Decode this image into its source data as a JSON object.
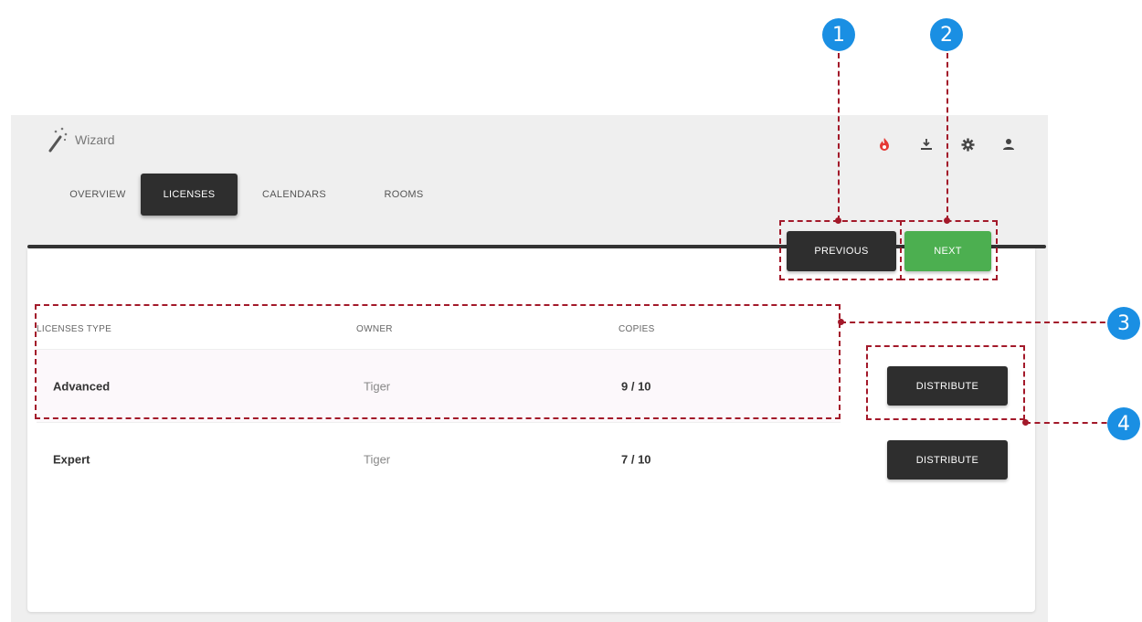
{
  "app": {
    "title": "Wizard"
  },
  "toolbar": {
    "icons": [
      "fire-icon",
      "download-icon",
      "gear-icon",
      "user-icon"
    ],
    "fire_color": "#e53935"
  },
  "tabs": [
    {
      "label": "OVERVIEW",
      "active": false
    },
    {
      "label": "LICENSES",
      "active": true
    },
    {
      "label": "CALENDARS",
      "active": false
    },
    {
      "label": "ROOMS",
      "active": false
    }
  ],
  "navigation": {
    "previous_label": "PREVIOUS",
    "next_label": "NEXT"
  },
  "table": {
    "headers": {
      "type": "LICENSES TYPE",
      "owner": "OWNER",
      "copies": "COPIES"
    },
    "rows": [
      {
        "type": "Advanced",
        "owner": "Tiger",
        "copies": "9 / 10",
        "action": "DISTRIBUTE"
      },
      {
        "type": "Expert",
        "owner": "Tiger",
        "copies": "7 / 10",
        "action": "DISTRIBUTE"
      }
    ]
  },
  "annotations": {
    "markers": [
      "1",
      "2",
      "3",
      "4"
    ],
    "color": "#a3192a",
    "marker_color": "#1a8fe3"
  }
}
